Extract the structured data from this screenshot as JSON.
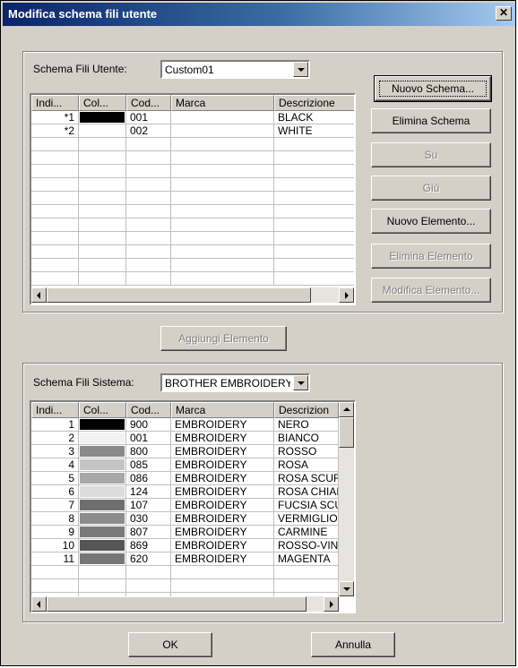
{
  "window": {
    "title": "Modifica schema fili utente",
    "close_label": "✕"
  },
  "user_scheme": {
    "label": "Schema Fili Utente:",
    "selected": "Custom01",
    "columns": [
      "Indi...",
      "Col...",
      "Cod...",
      "Marca",
      "Descrizione"
    ],
    "rows": [
      {
        "index": "*1",
        "color": "#000000",
        "code": "001",
        "brand": "",
        "desc": "BLACK"
      },
      {
        "index": "*2",
        "color": "#ffffff",
        "code": "002",
        "brand": "",
        "desc": "WHITE"
      }
    ]
  },
  "buttons": {
    "new_scheme": "Nuovo Schema...",
    "delete_scheme": "Elimina Schema",
    "up": "Su",
    "down": "Giù",
    "new_element": "Nuovo Elemento...",
    "delete_element": "Elimina Elemento",
    "edit_element": "Modifica Elemento...",
    "add_element": "Aggiungi Elemento",
    "ok": "OK",
    "cancel": "Annulla"
  },
  "system_scheme": {
    "label": "Schema Fili Sistema:",
    "selected": "BROTHER EMBROIDERY",
    "columns": [
      "Indi...",
      "Col...",
      "Cod...",
      "Marca",
      "Descrizion"
    ],
    "rows": [
      {
        "index": "1",
        "color": "#000000",
        "code": "900",
        "brand": "EMBROIDERY",
        "desc": "NERO"
      },
      {
        "index": "2",
        "color": "#f2f2f2",
        "code": "001",
        "brand": "EMBROIDERY",
        "desc": "BIANCO"
      },
      {
        "index": "3",
        "color": "#8a8a8a",
        "code": "800",
        "brand": "EMBROIDERY",
        "desc": "ROSSO"
      },
      {
        "index": "4",
        "color": "#c4c4c4",
        "code": "085",
        "brand": "EMBROIDERY",
        "desc": "ROSA"
      },
      {
        "index": "5",
        "color": "#a8a8a8",
        "code": "086",
        "brand": "EMBROIDERY",
        "desc": "ROSA SCURO"
      },
      {
        "index": "6",
        "color": "#dcdcdc",
        "code": "124",
        "brand": "EMBROIDERY",
        "desc": "ROSA CHIARO"
      },
      {
        "index": "7",
        "color": "#6e6e6e",
        "code": "107",
        "brand": "EMBROIDERY",
        "desc": "FUCSIA SCURO"
      },
      {
        "index": "8",
        "color": "#8c8c8c",
        "code": "030",
        "brand": "EMBROIDERY",
        "desc": "VERMIGLIO"
      },
      {
        "index": "9",
        "color": "#7a7a7a",
        "code": "807",
        "brand": "EMBROIDERY",
        "desc": "CARMINE"
      },
      {
        "index": "10",
        "color": "#555555",
        "code": "869",
        "brand": "EMBROIDERY",
        "desc": "ROSSO-VINO"
      },
      {
        "index": "11",
        "color": "#777777",
        "code": "620",
        "brand": "EMBROIDERY",
        "desc": "MAGENTA"
      }
    ]
  }
}
